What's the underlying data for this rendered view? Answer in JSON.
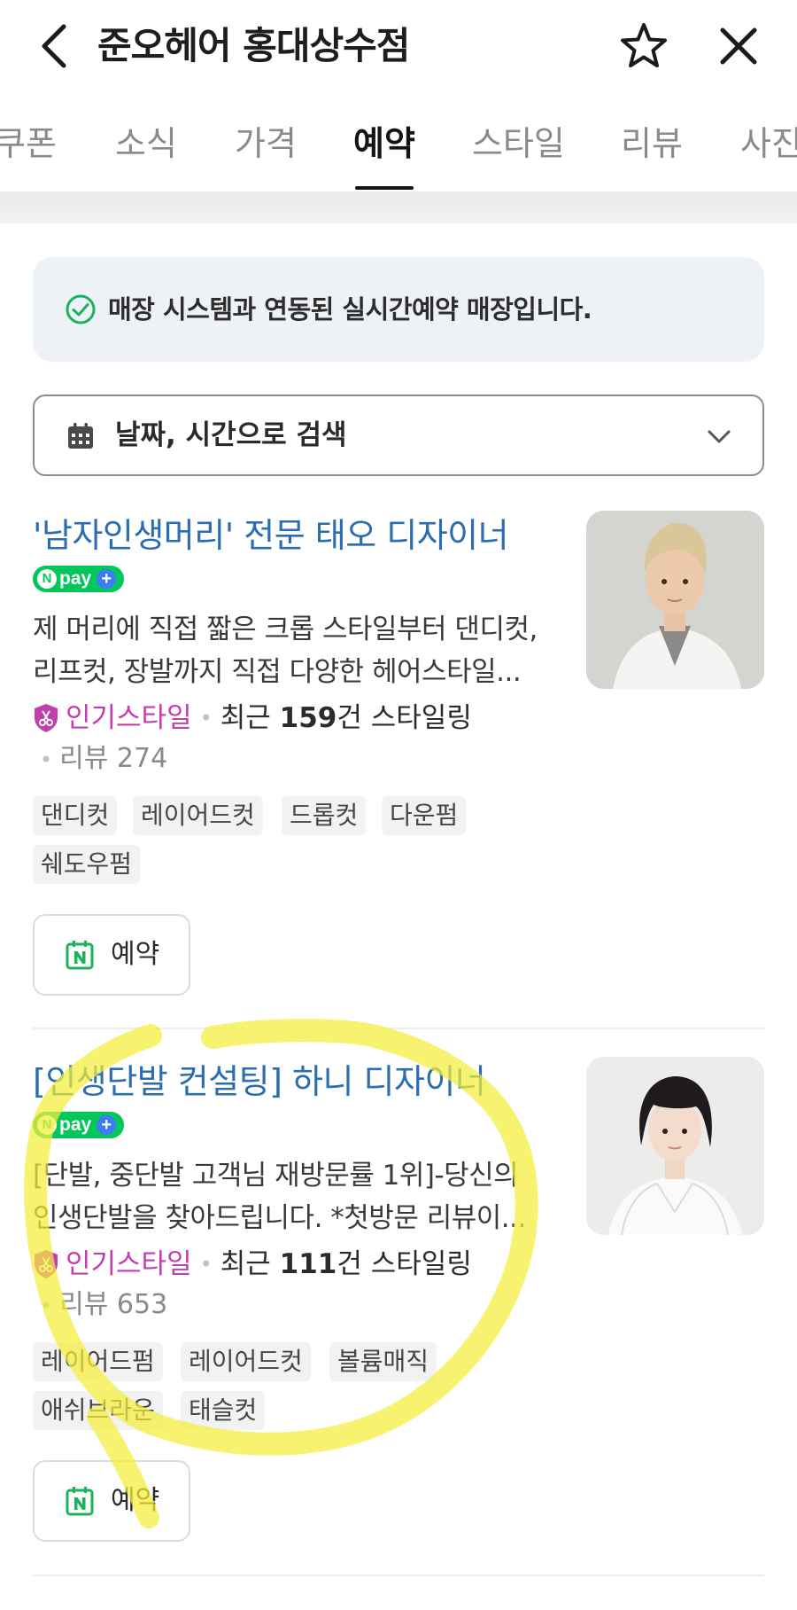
{
  "header": {
    "title": "준오헤어 홍대상수점",
    "back_icon": "chevron-left-icon",
    "favorite_icon": "star-outline-icon",
    "close_icon": "close-icon"
  },
  "tabs": [
    {
      "label": "쿠폰",
      "active": false
    },
    {
      "label": "소식",
      "active": false
    },
    {
      "label": "가격",
      "active": false
    },
    {
      "label": "예약",
      "active": true
    },
    {
      "label": "스타일",
      "active": false
    },
    {
      "label": "리뷰",
      "active": false
    },
    {
      "label": "사진",
      "active": false
    }
  ],
  "notice": {
    "text": "매장 시스템과 연동된 실시간예약 매장입니다.",
    "icon": "check-circle-icon"
  },
  "date_search": {
    "label": "날짜, 시간으로 검색",
    "icon": "calendar-icon",
    "dropdown_icon": "chevron-down-icon"
  },
  "designers": [
    {
      "title": "'남자인생머리' 전문 태오 디자이너",
      "npay": {
        "n": "N",
        "text": "pay",
        "plus": "+"
      },
      "desc_line1": "제 머리에 직접 짧은 크롭 스타일부터 댄디컷,",
      "desc_line2": "리프컷, 장발까지 직접 다양한 헤어스타일...",
      "popular_label": "인기스타일",
      "recent_prefix": "최근 ",
      "recent_count": "159",
      "recent_suffix": "건 스타일링",
      "review_label": "리뷰 274",
      "tags": [
        "댄디컷",
        "레이어드컷",
        "드롭컷",
        "다운펌",
        "쉐도우펌"
      ],
      "reserve_label": "예약"
    },
    {
      "title": "[인생단발 컨설팅] 하니 디자이너",
      "npay": {
        "n": "N",
        "text": "pay",
        "plus": "+"
      },
      "desc_line1": "[단발, 중단발 고객님 재방문률 1위]-당신의",
      "desc_line2": "인생단발을 찾아드립니다. *첫방문 리뷰이...",
      "popular_label": "인기스타일",
      "recent_prefix": "최근 ",
      "recent_count": "111",
      "recent_suffix": "건 스타일링",
      "review_label": "리뷰 653",
      "tags": [
        "레이어드펌",
        "레이어드컷",
        "볼륨매직",
        "애쉬브라운",
        "태슬컷"
      ],
      "reserve_label": "예약"
    }
  ],
  "colors": {
    "title_link": "#2a6db0",
    "popular": "#c23fae",
    "npay_green": "#03c75a",
    "highlight": "#f4ee3a"
  }
}
